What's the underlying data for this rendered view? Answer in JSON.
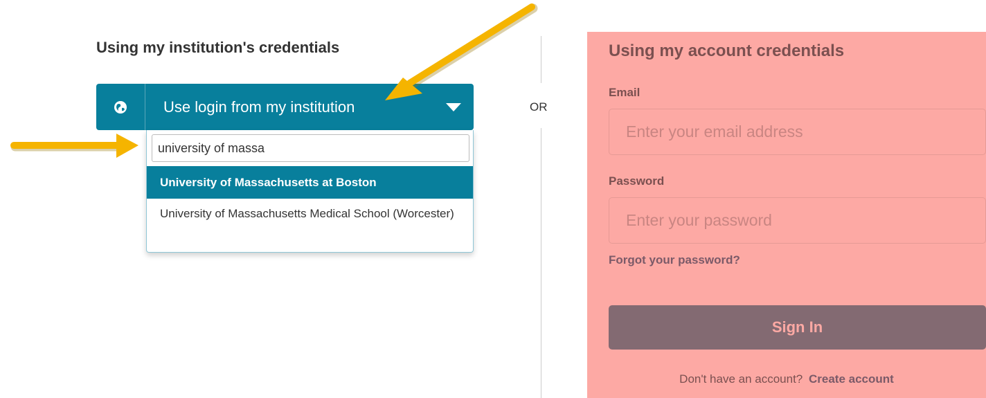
{
  "left": {
    "title": "Using my institution's credentials",
    "select": {
      "label": "Use login from my institution",
      "search_value": "university of massa",
      "options": [
        "University of Massachusetts at Boston",
        "University of Massachusetts Medical School (Worcester)"
      ]
    }
  },
  "divider": {
    "or_text": "OR"
  },
  "right": {
    "title": "Using my account credentials",
    "email_label": "Email",
    "email_placeholder": "Enter your email address",
    "password_label": "Password",
    "password_placeholder": "Enter your password",
    "forgot": "Forgot your password?",
    "signin": "Sign In",
    "no_account": "Don't have an account?",
    "create_account": "Create account"
  },
  "colors": {
    "teal": "#087f9c",
    "panel_overlay": "#fda9a4",
    "annotation_arrow": "#f5b400",
    "signin_button": "#836a72"
  },
  "icons": {
    "globe": "globe-icon",
    "dropdown": "caret-down-icon",
    "annotation": "arrow-icon"
  }
}
